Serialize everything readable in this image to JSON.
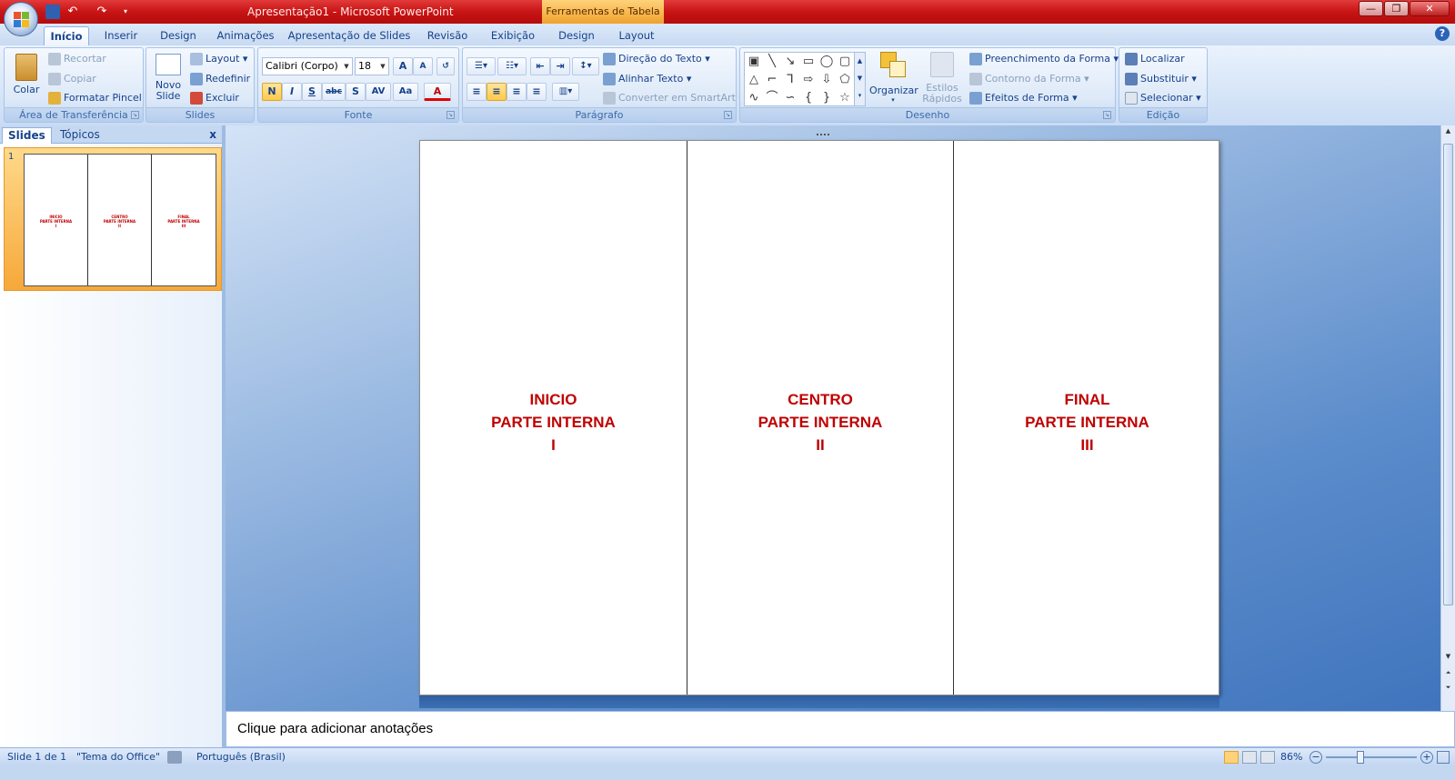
{
  "window": {
    "title": "Apresentação1 - Microsoft PowerPoint",
    "context_tab": "Ferramentas de Tabela",
    "controls": {
      "minimize": "—",
      "restore": "❐",
      "close": "✕"
    }
  },
  "tabs": [
    "Início",
    "Inserir",
    "Design",
    "Animações",
    "Apresentação de Slides",
    "Revisão",
    "Exibição",
    "Design",
    "Layout"
  ],
  "active_tab": "Início",
  "ribbon": {
    "clipboard": {
      "label": "Área de Transferência",
      "paste": "Colar",
      "cut": "Recortar",
      "copy": "Copiar",
      "format_painter": "Formatar Pincel"
    },
    "slides": {
      "label": "Slides",
      "new_slide_1": "Novo",
      "new_slide_2": "Slide",
      "layout": "Layout",
      "reset": "Redefinir",
      "delete": "Excluir"
    },
    "font": {
      "label": "Fonte",
      "font_name": "Calibri (Corpo)",
      "font_size": "18",
      "grow": "A",
      "shrink": "A",
      "bold": "N",
      "italic": "I",
      "underline": "S",
      "strike": "abc",
      "shadow": "S",
      "spacing": "AV",
      "case": "Aa",
      "color": "A"
    },
    "paragraph": {
      "label": "Parágrafo",
      "text_direction": "Direção do Texto",
      "align_text": "Alinhar Texto",
      "smartart": "Converter em SmartArt"
    },
    "drawing": {
      "label": "Desenho",
      "arrange": "Organizar",
      "quick_styles_1": "Estilos",
      "quick_styles_2": "Rápidos",
      "fill": "Preenchimento da Forma",
      "outline": "Contorno da Forma",
      "effects": "Efeitos de Forma"
    },
    "editing": {
      "label": "Edição",
      "find": "Localizar",
      "replace": "Substituir",
      "select": "Selecionar"
    }
  },
  "pane": {
    "tab_slides": "Slides",
    "tab_outline": "Tópicos",
    "close": "x",
    "slide_number": "1",
    "thumb_cols": [
      {
        "l1": "INICIO",
        "l2": "PARTE INTERNA",
        "l3": "I"
      },
      {
        "l1": "CENTRO",
        "l2": "PARTE INTERNA",
        "l3": "II"
      },
      {
        "l1": "FINAL",
        "l2": "PARTE INTERNA",
        "l3": "III"
      }
    ]
  },
  "slide": {
    "columns": [
      {
        "l1": "INICIO",
        "l2": "PARTE INTERNA",
        "l3": "I"
      },
      {
        "l1": "CENTRO",
        "l2": "PARTE INTERNA",
        "l3": "II"
      },
      {
        "l1": "FINAL",
        "l2": "PARTE INTERNA",
        "l3": "III"
      }
    ],
    "text_color": "#c00000"
  },
  "notes": {
    "placeholder": "Clique para adicionar anotações"
  },
  "status": {
    "slide": "Slide 1 de 1",
    "theme": "\"Tema do Office\"",
    "language": "Português (Brasil)",
    "zoom": "86%",
    "zoom_minus": "−",
    "zoom_plus": "+"
  }
}
